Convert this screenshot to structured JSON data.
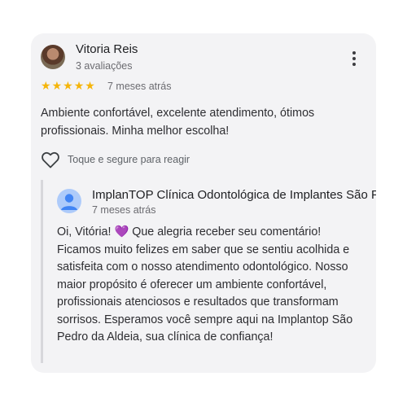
{
  "review": {
    "author_name": "Vitoria Reis",
    "author_reviews": "3 avaliações",
    "rating": 5,
    "rating_max": 5,
    "star_color": "#f5b50a",
    "time": "7 meses atrás",
    "text": "Ambiente confortável, excelente atendimento, ótimos profissionais. Minha melhor escolha!",
    "react_label": "Toque e segure para reagir",
    "icons": {
      "menu": "more-vert-icon",
      "react": "heart-outline-icon"
    }
  },
  "reply": {
    "owner_name": "ImplanTOP Clínica Odontológica de Implantes São Pe",
    "time": "7 meses atrás",
    "text": "Oi, Vitória! 💜 Que alegria receber seu comentário! Ficamos muito felizes em saber que se sentiu acolhida e satisfeita com o nosso atendimento odontológico. Nosso maior propósito é oferecer um ambiente confortável, profissionais atenciosos e resultados que transformam sorrisos. Esperamos você sempre aqui na Implantop São Pedro da Aldeia, sua clínica de confiança!",
    "icons": {
      "avatar": "default-profile-icon"
    }
  }
}
